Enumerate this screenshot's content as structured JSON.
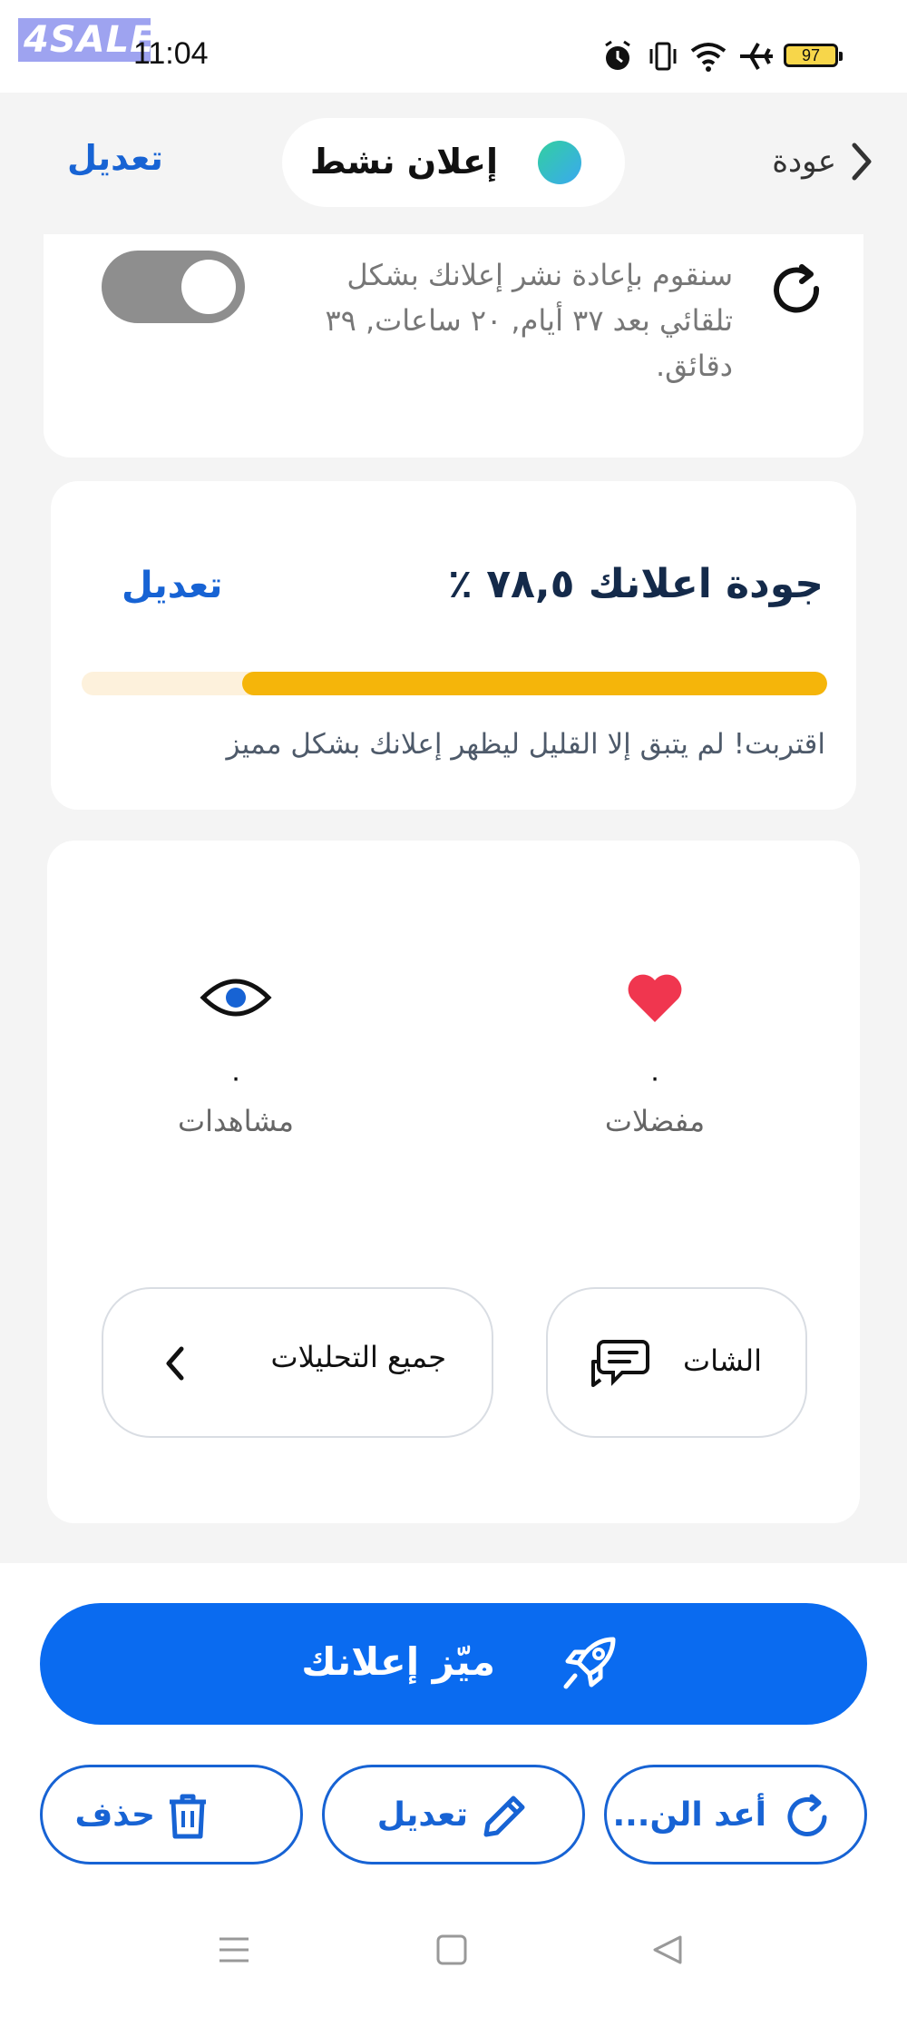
{
  "status_bar": {
    "watermark": "4SALE",
    "time": "11:04",
    "battery": "97",
    "icons": [
      "alarm-icon",
      "vibrate-icon",
      "wifi-icon",
      "airplane-icon",
      "battery-icon"
    ]
  },
  "header": {
    "back_label": "عودة",
    "status_text": "إعلان نشط",
    "edit_label": "تعديل"
  },
  "republish": {
    "text": "سنقوم بإعادة نشر إعلانك بشكل تلقائي بعد ٣٧ أيام, ٢٠ ساعات, ٣٩ دقائق.",
    "toggle_on": false
  },
  "quality": {
    "title": "جودة اعلانك ٧٨,٥ ٪",
    "edit_label": "تعديل",
    "progress_percent": 78.5,
    "hint": "اقتربت! لم يتبق إلا القليل ليظهر إعلانك بشكل مميز"
  },
  "stats": {
    "favorites": {
      "value": "٠",
      "label": "مفضلات"
    },
    "views": {
      "value": "٠",
      "label": "مشاهدات"
    }
  },
  "actions": {
    "chat_label": "الشات",
    "analytics_label": "جميع التحليلات"
  },
  "bottom": {
    "promote_label": "ميّز إعلانك",
    "repost_label": "أعد الن...",
    "edit_label": "تعديل",
    "delete_label": "حذف"
  },
  "colors": {
    "primary": "#0a6bf0",
    "link_blue": "#1763d4",
    "progress": "#f5b50a",
    "heart": "#f0364f",
    "background": "#f4f4f4"
  }
}
